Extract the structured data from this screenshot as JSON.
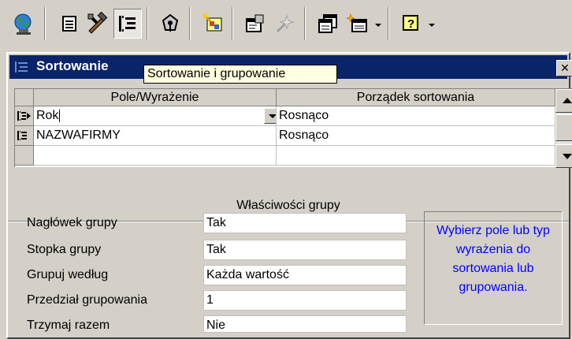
{
  "toolbar": {
    "buttons": [
      {
        "icon": "globe-icon"
      },
      {
        "icon": "properties-icon"
      },
      {
        "icon": "toolbox-icon"
      },
      {
        "icon": "sorting-grouping-icon",
        "pressed": true
      },
      {
        "icon": "field-list-icon"
      },
      {
        "icon": "autoformat-icon"
      },
      {
        "icon": "code-icon"
      },
      {
        "icon": "build-icon"
      },
      {
        "icon": "database-window-icon"
      },
      {
        "icon": "new-object-icon"
      },
      {
        "icon": "help-icon"
      }
    ]
  },
  "dialog": {
    "title": "Sortowanie",
    "tooltip": "Sortowanie i grupowanie",
    "close_glyph": "✕",
    "grid": {
      "headers": [
        "Pole/Wyrażenie",
        "Porządek sortowania"
      ],
      "rows": [
        {
          "field": "Rok",
          "order": "Rosnąco"
        },
        {
          "field": "NAZWAFIRMY",
          "order": "Rosnąco"
        },
        {
          "field": "",
          "order": ""
        }
      ]
    },
    "properties": {
      "title": "Właściwości grupy",
      "items": [
        {
          "label": "Nagłówek grupy",
          "value": "Tak"
        },
        {
          "label": "Stopka grupy",
          "value": "Tak"
        },
        {
          "label": "Grupuj według",
          "value": "Każda wartość"
        },
        {
          "label": "Przedział grupowania",
          "value": "1"
        },
        {
          "label": "Trzymaj razem",
          "value": "Nie"
        }
      ],
      "help_text": "Wybierz pole lub typ wyrażenia do sortowania lub grupowania."
    }
  },
  "colors": {
    "titlebar": "#0a246a",
    "tooltip_bg": "#ffffe1",
    "help_text": "#0000ff",
    "face": "#d4d0c8"
  }
}
